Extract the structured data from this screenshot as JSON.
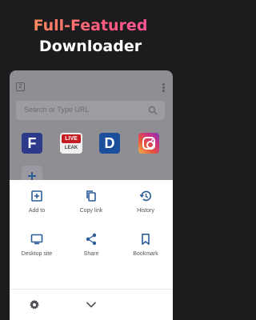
{
  "headline": {
    "line1": "Full-Featured",
    "line2": "Downloader"
  },
  "browser": {
    "tab_count": "2",
    "search_placeholder": "Search or Type URL"
  },
  "shortcuts": [
    {
      "name": "F",
      "label": "F"
    },
    {
      "name": "Live Leak",
      "line1": "LIVE",
      "line2": "LEAK"
    },
    {
      "name": "D",
      "label": "D"
    },
    {
      "name": "Instagram"
    }
  ],
  "menu": {
    "items": [
      {
        "label": "Add to",
        "icon": "add-box-icon"
      },
      {
        "label": "Copy link",
        "icon": "copy-icon"
      },
      {
        "label": "History",
        "icon": "history-icon"
      },
      {
        "label": "Desktop site",
        "icon": "desktop-icon"
      },
      {
        "label": "Share",
        "icon": "share-icon"
      },
      {
        "label": "Bookmark",
        "icon": "bookmark-icon"
      }
    ]
  },
  "colors": {
    "accent": "#2a5d98",
    "headline_gradient_start": "#ffa24a",
    "headline_gradient_end": "#ff4fa8"
  }
}
